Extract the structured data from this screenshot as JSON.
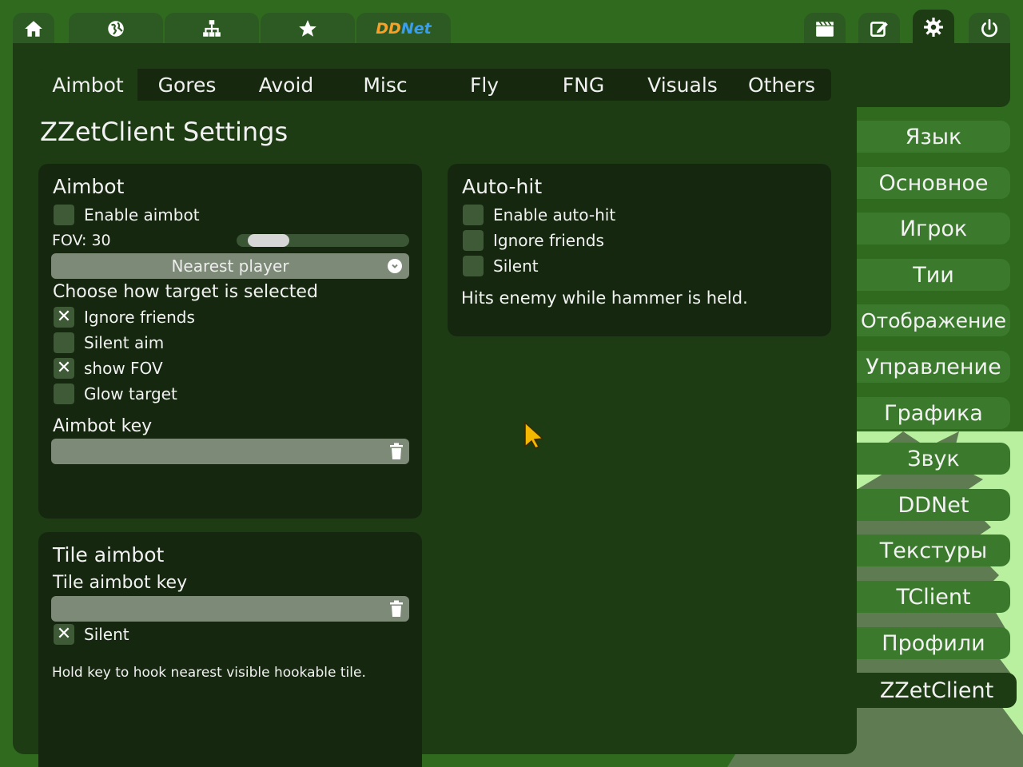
{
  "topbar": {
    "icons": [
      "home-icon",
      "globe-icon",
      "network-icon",
      "star-icon"
    ],
    "ddnet_logo": {
      "text_dd": "DD",
      "text_net": "Net",
      "color_dd": "#f7a02a",
      "color_net": "#3a9ef0"
    },
    "right_icons": [
      "clapperboard-icon",
      "edit-icon",
      "gear-icon",
      "power-icon"
    ]
  },
  "subtabs": [
    "Aimbot",
    "Gores",
    "Avoid",
    "Misc",
    "Fly",
    "FNG",
    "Visuals",
    "Others"
  ],
  "page_title": "ZZetClient Settings",
  "aimbot": {
    "title": "Aimbot",
    "enable_label": "Enable aimbot",
    "fov_label": "FOV: 30",
    "fov_value": 30,
    "target_mode": "Nearest player",
    "target_help": "Choose how target is selected",
    "options": [
      {
        "label": "Ignore friends",
        "checked": true
      },
      {
        "label": "Silent aim",
        "checked": false
      },
      {
        "label": "show FOV",
        "checked": true
      },
      {
        "label": "Glow target",
        "checked": false
      }
    ],
    "key_label": "Aimbot key"
  },
  "tile_aimbot": {
    "title": "Tile aimbot",
    "key_label": "Tile aimbot key",
    "silent_label": "Silent",
    "hint": "Hold key to hook nearest visible hookable tile."
  },
  "autohit": {
    "title": "Auto-hit",
    "options": [
      {
        "label": "Enable auto-hit",
        "checked": false
      },
      {
        "label": "Ignore friends",
        "checked": false
      },
      {
        "label": "Silent",
        "checked": false
      }
    ],
    "hint": "Hits enemy while hammer is held."
  },
  "sidebar": [
    "Язык",
    "Основное",
    "Игрок",
    "Тии",
    "Отображение",
    "Управление",
    "Графика",
    "Звук",
    "DDNet",
    "Текстуры",
    "TClient",
    "Профили",
    "ZZetClient"
  ],
  "check_mark": "✕",
  "colors": {
    "panel": "#1e3c14",
    "card": "#15280f",
    "accent_side": "#3b7a2c",
    "cursor": "#f5b800"
  }
}
